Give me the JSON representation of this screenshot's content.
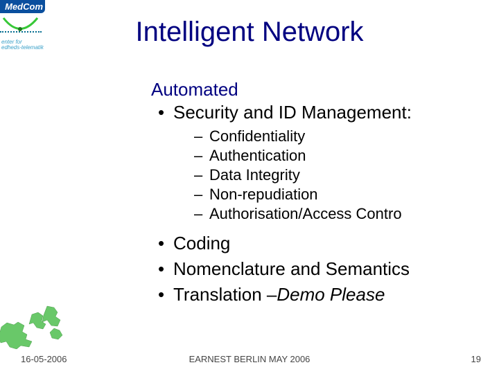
{
  "logo": {
    "brand": "MedCom",
    "sub1": "enter for",
    "sub2": "edheds-telematik"
  },
  "title": "Intelligent Network",
  "subheading": "Automated",
  "bullets_top": {
    "item1": "Security and ID Management:"
  },
  "sub_bullets": {
    "s1": "Confidentiality",
    "s2": "Authentication",
    "s3": "Data Integrity",
    "s4": "Non-repudiation",
    "s5": "Authorisation/Access Contro"
  },
  "bullets_bottom": {
    "b1": "Coding",
    "b2": "Nomenclature and Semantics",
    "b3_prefix": "Translation –",
    "b3_italic": "Demo Please"
  },
  "footer": {
    "date": "16-05-2006",
    "center": "EARNEST BERLIN MAY 2006",
    "page": "19"
  }
}
